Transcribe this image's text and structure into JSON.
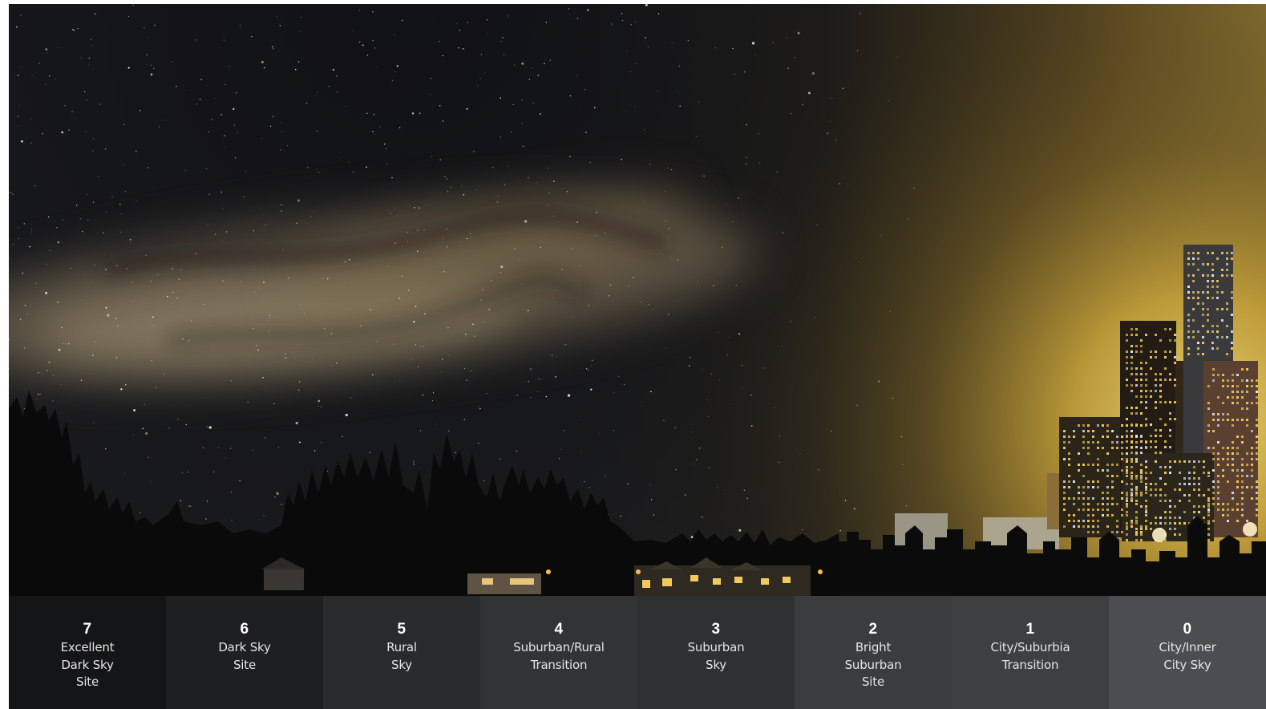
{
  "scale": [
    {
      "number": "7",
      "label": "Excellent\nDark Sky\nSite",
      "bg": "#141516"
    },
    {
      "number": "6",
      "label": "Dark Sky\nSite",
      "bg": "#1e1f21"
    },
    {
      "number": "5",
      "label": "Rural\nSky",
      "bg": "#282a2c"
    },
    {
      "number": "4",
      "label": "Suburban/Rural\nTransition",
      "bg": "#313335"
    },
    {
      "number": "3",
      "label": "Suburban\nSky",
      "bg": "#2e3032"
    },
    {
      "number": "2",
      "label": "Bright\nSuburban\nSite",
      "bg": "#3a3c3e"
    },
    {
      "number": "1",
      "label": "City/Suburbia\nTransition",
      "bg": "#3d3f41"
    },
    {
      "number": "0",
      "label": "City/Inner\nCity Sky",
      "bg": "#4b4d50"
    }
  ],
  "colors": {
    "sky_dark": "#0e0f13",
    "milky_way": "#8a7a5e",
    "city_glow": "#c9a53c",
    "silhouette": "#0a0a0a",
    "window_light": "#f2c95a"
  }
}
